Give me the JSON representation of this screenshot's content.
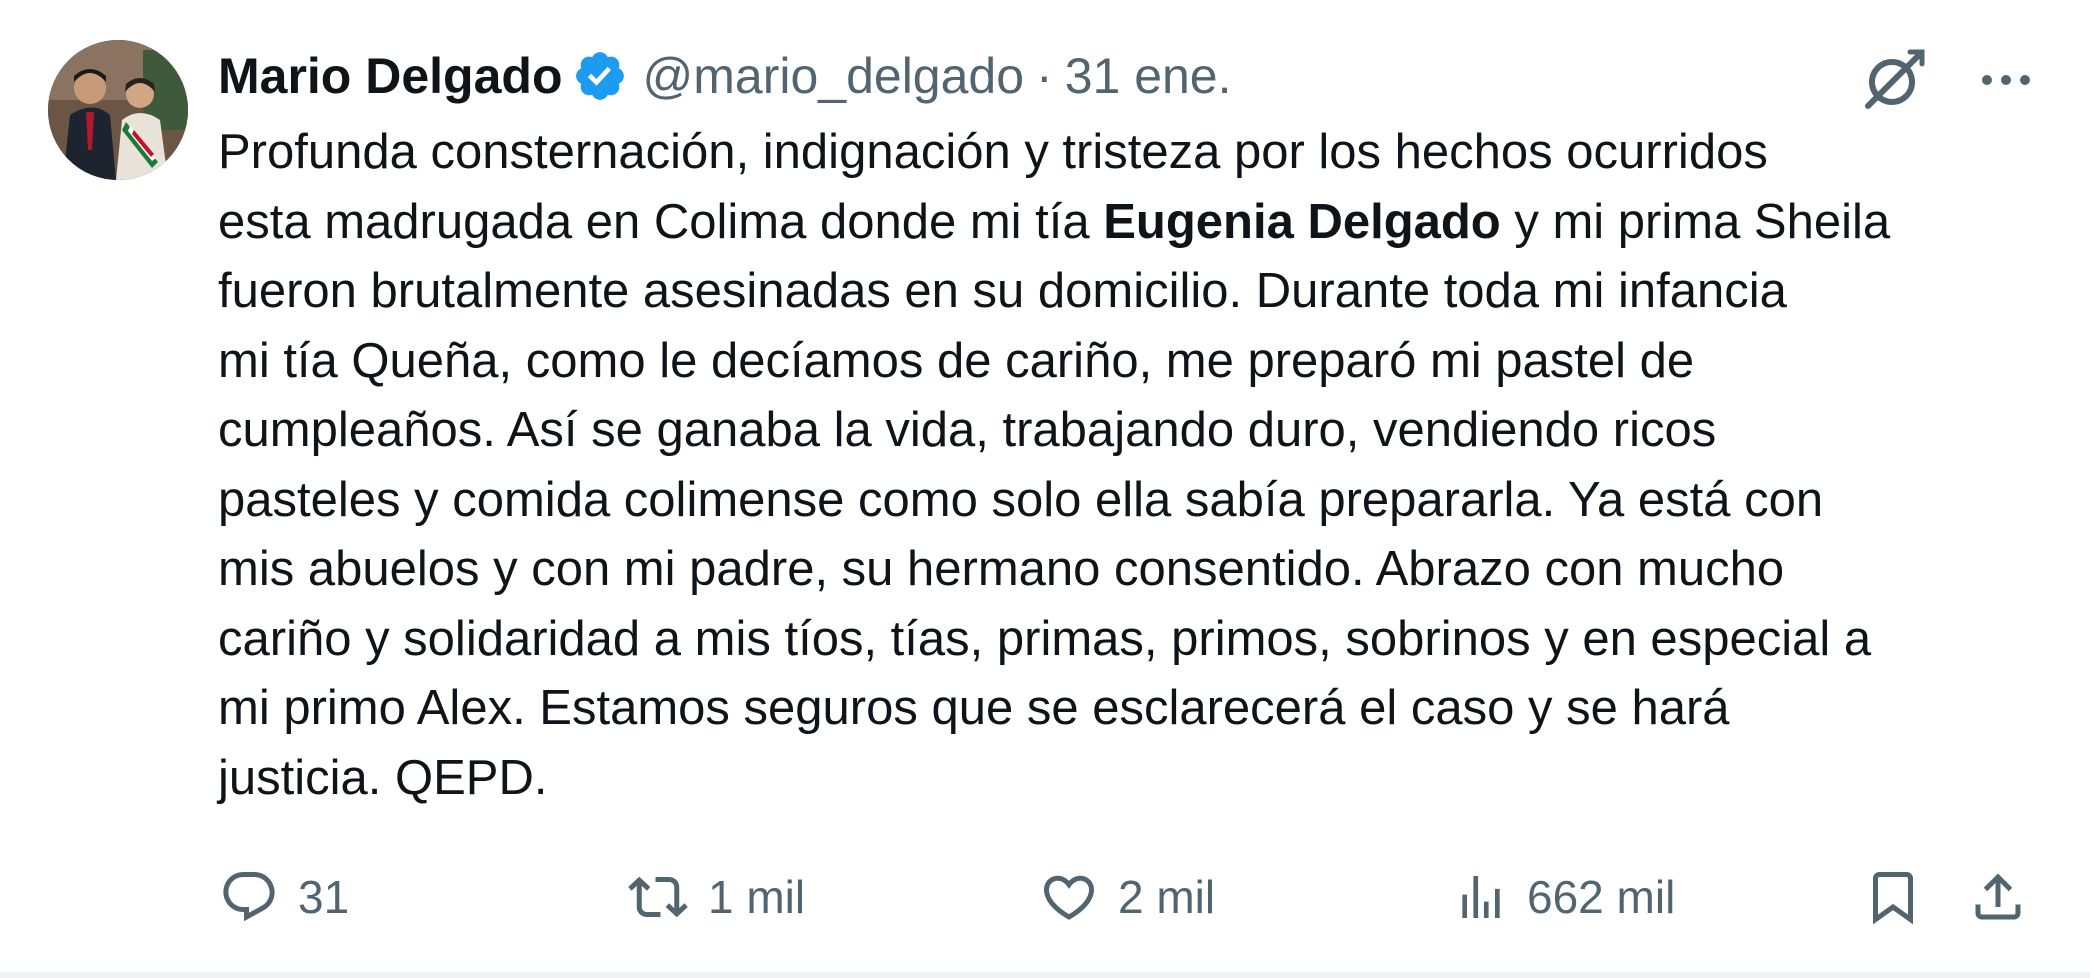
{
  "author": {
    "name": "Mario Delgado",
    "handle": "@mario_delgado",
    "separator": "·",
    "date": "31 ene."
  },
  "icons": {
    "avatar": "profile-photo",
    "verified": "verified-badge-icon",
    "grok": "grok-icon",
    "more": "more-options-icon",
    "reply": "reply-icon",
    "retweet": "retweet-icon",
    "like": "heart-icon",
    "views": "views-chart-icon",
    "bookmark": "bookmark-icon",
    "share": "share-icon"
  },
  "tweet": {
    "lines": [
      {
        "before": "Profunda consternación, indignación y tristeza por los hechos ocurridos",
        "bold": "",
        "after": ""
      },
      {
        "before": "esta madrugada en Colima donde mi tía ",
        "bold": "Eugenia Delgado",
        "after": " y mi prima Sheila"
      },
      {
        "before": "fueron brutalmente asesinadas en su domicilio. Durante toda mi infancia",
        "bold": "",
        "after": ""
      },
      {
        "before": "mi tía Queña, como le decíamos de cariño, me preparó mi pastel de",
        "bold": "",
        "after": ""
      },
      {
        "before": "cumpleaños. Así se ganaba la vida, trabajando duro, vendiendo ricos",
        "bold": "",
        "after": ""
      },
      {
        "before": "pasteles y comida colimense como solo ella sabía prepararla. Ya está con",
        "bold": "",
        "after": ""
      },
      {
        "before": "mis abuelos y con mi padre, su hermano consentido. Abrazo con mucho",
        "bold": "",
        "after": ""
      },
      {
        "before": "cariño y solidaridad a mis tíos, tías, primas, primos, sobrinos y en especial a",
        "bold": "",
        "after": ""
      },
      {
        "before": "mi primo Alex. Estamos seguros que se esclarecerá el caso y se hará",
        "bold": "",
        "after": ""
      },
      {
        "before": "justicia. QEPD.",
        "bold": "",
        "after": ""
      }
    ]
  },
  "stats": {
    "replies": "31",
    "retweets": "1 mil",
    "likes": "2 mil",
    "views": "662 mil"
  },
  "colors": {
    "text": "#0f1419",
    "secondary": "#536471",
    "verified": "#1d9bf0"
  }
}
